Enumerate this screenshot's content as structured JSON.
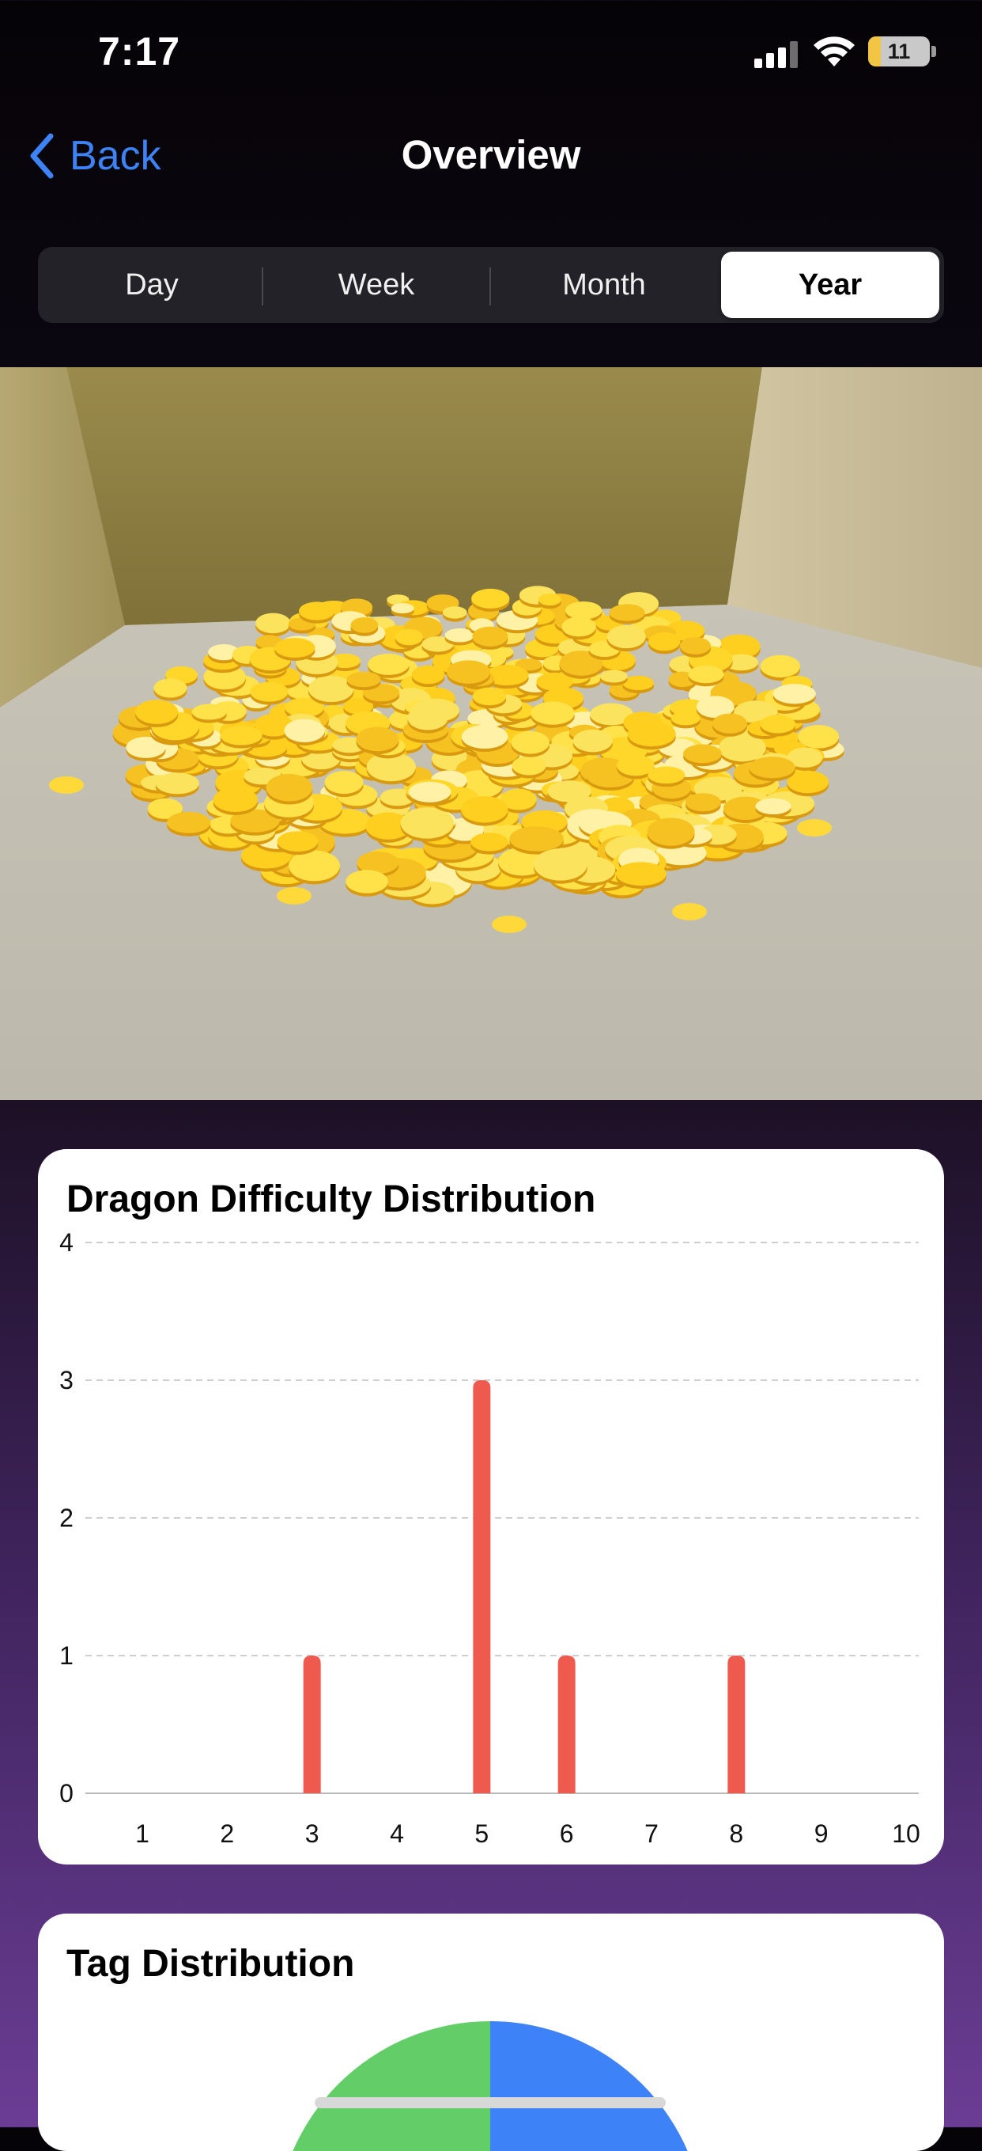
{
  "status_bar": {
    "time": "7:17",
    "battery": "11",
    "icons": [
      "signal-bars-icon",
      "wifi-icon",
      "battery-icon"
    ]
  },
  "nav": {
    "back_label": "Back",
    "title": "Overview"
  },
  "segmented": {
    "options": [
      "Day",
      "Week",
      "Month",
      "Year"
    ],
    "selected": "Year"
  },
  "scene": {
    "description_icon": "coin-pile-3d"
  },
  "difficulty_card": {
    "title": "Dragon Difficulty Distribution"
  },
  "tag_card": {
    "title": "Tag Distribution",
    "colors": [
      "#63cd67",
      "#3d82f6"
    ]
  },
  "colors": {
    "accent_blue": "#3d83f6",
    "bar_red": "#ee5a4d"
  },
  "chart_data": {
    "type": "bar",
    "title": "Dragon Difficulty Distribution",
    "categories": [
      "1",
      "2",
      "3",
      "4",
      "5",
      "6",
      "7",
      "8",
      "9",
      "10"
    ],
    "values": [
      0,
      0,
      1,
      0,
      3,
      1,
      0,
      1,
      0,
      0
    ],
    "yticks": [
      "0",
      "1",
      "2",
      "3",
      "4"
    ],
    "ylim": [
      0,
      4
    ],
    "grid": true,
    "color": "#ee5a4d"
  }
}
